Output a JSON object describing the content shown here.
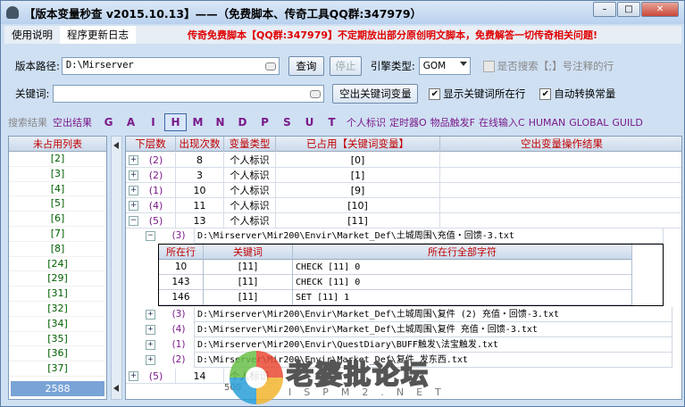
{
  "window": {
    "title": "【版本变量秒查 v2015.10.13】——（免费脚本、传奇工具QQ群:347979）",
    "controls": {
      "min": "–",
      "max": "□",
      "close": "✕"
    }
  },
  "menu": {
    "items": [
      "使用说明",
      "程序更新日志"
    ],
    "notice": "传奇免费脚本【QQ群:347979】不定期放出部分原创明文脚本，免费解答一切传奇相关问题!"
  },
  "form": {
    "path_label": "版本路径:",
    "path_value": "D:\\Mirserver",
    "query_button": "查询",
    "stop_button": "停止",
    "engine_label": "引擎类型:",
    "engine_value": "GOM",
    "search_comment_label": "是否搜索【;】号注释的行",
    "keyword_label": "关键词:",
    "keyword_value": "",
    "output_button": "空出关键词变量",
    "show_line_label": "显示关键词所在行",
    "auto_convert_label": "自动转换常量"
  },
  "tags": {
    "label": "搜索结果",
    "empty": "空出结果",
    "letters": [
      "G",
      "A",
      "I",
      "H",
      "M",
      "N",
      "D",
      "P",
      "S",
      "U",
      "T"
    ],
    "selected": "H",
    "extras": [
      "个人标识",
      "定时器O",
      "物品触发F",
      "在线输入C",
      "HUMAN",
      "GLOBAL",
      "GUILD"
    ]
  },
  "unused": {
    "header": "未占用列表",
    "items": [
      "[2]",
      "[3]",
      "[4]",
      "[5]",
      "[6]",
      "[7]",
      "[8]",
      "[24]",
      "[29]",
      "[31]",
      "[32]",
      "[34]",
      "[35]",
      "[36]",
      "[37]"
    ],
    "total": "2588"
  },
  "table": {
    "headers": [
      "下层数",
      "出现次数",
      "变量类型",
      "已占用【关键词变量】",
      "空出变量操作结果"
    ],
    "rows": [
      {
        "count": "(2)",
        "times": "8",
        "type": "个人标识",
        "var": "[0]"
      },
      {
        "count": "(2)",
        "times": "3",
        "type": "个人标识",
        "var": "[1]"
      },
      {
        "count": "(1)",
        "times": "10",
        "type": "个人标识",
        "var": "[9]"
      },
      {
        "count": "(4)",
        "times": "11",
        "type": "个人标识",
        "var": "[10]"
      },
      {
        "count": "(5)",
        "times": "13",
        "type": "个人标识",
        "var": "[11]"
      }
    ],
    "files": [
      {
        "count": "(3)",
        "path": "D:\\Mirserver\\Mir200\\Envir\\Market_Def\\土城周围\\充值・回馈-3.txt"
      },
      {
        "count": "(3)",
        "path": "D:\\Mirserver\\Mir200\\Envir\\Market_Def\\土城周围\\复件 (2) 充值・回馈-3.txt"
      },
      {
        "count": "(4)",
        "path": "D:\\Mirserver\\Mir200\\Envir\\Market_Def\\土城周围\\复件 充值・回馈-3.txt"
      },
      {
        "count": "(1)",
        "path": "D:\\Mirserver\\Mir200\\Envir\\QuestDiary\\BUFF触发\\法宝触发.txt"
      },
      {
        "count": "(2)",
        "path": "D:\\Mirserver\\Mir200\\Envir\\Market_Def\\复件 发东西.txt"
      }
    ],
    "inner_headers": [
      "所在行",
      "关键词",
      "所在行全部字符"
    ],
    "inner_rows": [
      {
        "line": "10",
        "kw": "[11]",
        "text": "CHECK [11] 0"
      },
      {
        "line": "143",
        "kw": "[11]",
        "text": "CHECK [11] 0"
      },
      {
        "line": "146",
        "kw": "[11]",
        "text": "SET [11] 1"
      }
    ],
    "last_row": {
      "count": "(5)",
      "times": "14",
      "type": "个人标识"
    }
  },
  "status": "500",
  "watermark": {
    "text": "老婆批论坛",
    "sub": "ISPM2.NET"
  }
}
